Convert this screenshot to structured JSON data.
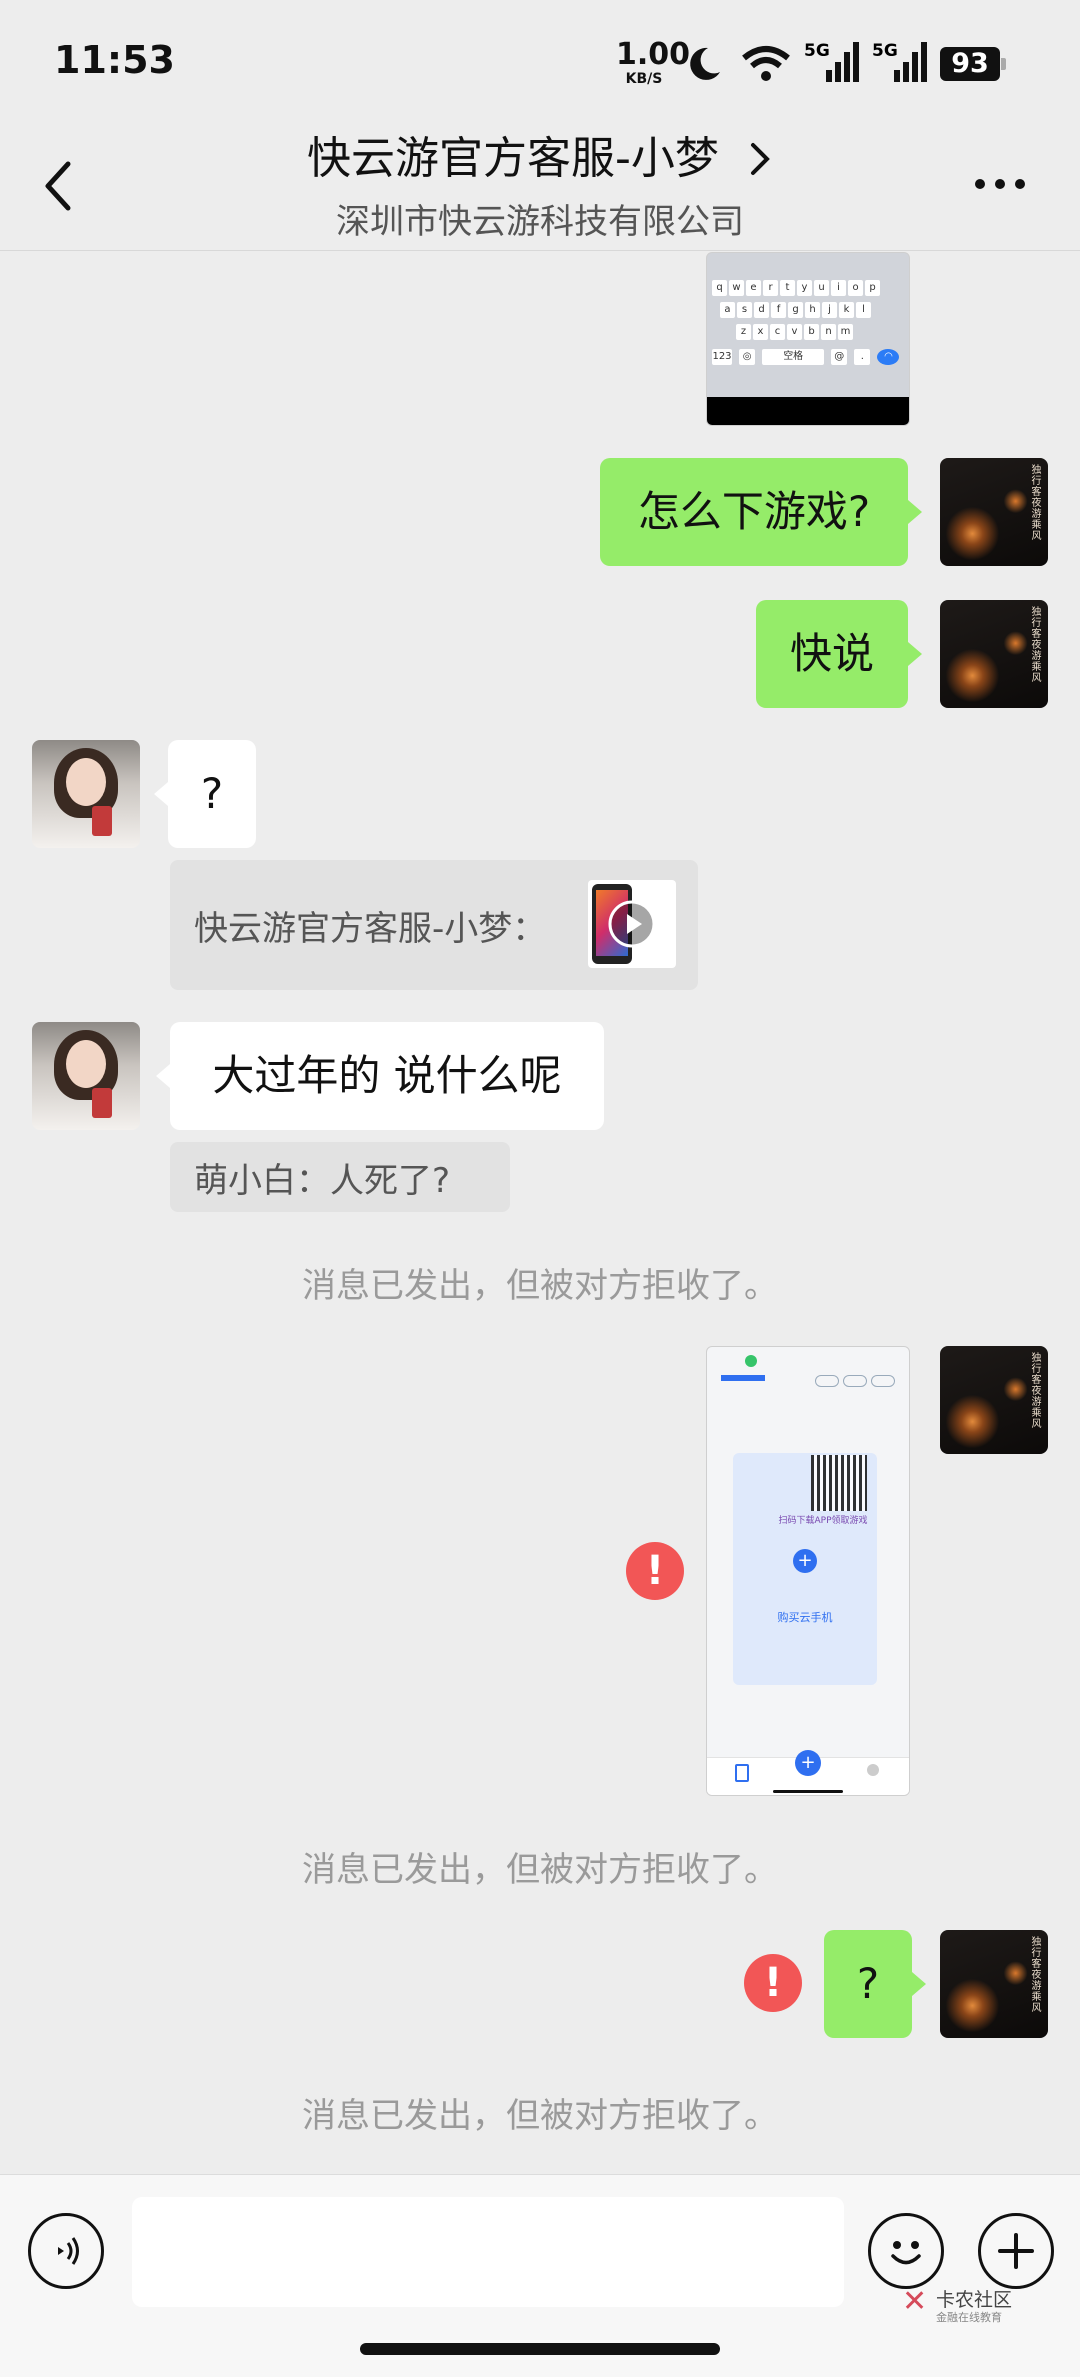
{
  "status_bar": {
    "time": "11:53",
    "net_speed_value": "1.00",
    "net_speed_unit": "KB/S",
    "battery": "93",
    "icons": [
      "moon-icon",
      "wifi-icon",
      "signal-5g-icon",
      "signal-5g-icon"
    ]
  },
  "header": {
    "title": "快云游官方客服-小梦",
    "subtitle": "深圳市快云游科技有限公司",
    "back_icon": "chevron-left-icon",
    "title_arrow_icon": "chevron-right-icon",
    "more_icon": "more-icon"
  },
  "keyboard_rows": [
    [
      "q",
      "w",
      "e",
      "r",
      "t",
      "y",
      "u",
      "i",
      "o",
      "p"
    ],
    [
      "a",
      "s",
      "d",
      "f",
      "g",
      "h",
      "j",
      "k",
      "l"
    ],
    [
      "z",
      "x",
      "c",
      "v",
      "b",
      "n",
      "m"
    ]
  ],
  "keyboard_bottom": {
    "num": "123",
    "space": "空格"
  },
  "messages": {
    "m1": "怎么下游戏?",
    "m2": "快说",
    "m3": "?",
    "quote1": "快云游官方客服-小梦：",
    "m4": "大过年的 说什么呢",
    "quote2": "萌小白：人死了?",
    "sys1": "消息已发出，但被对方拒收了。",
    "shot2_plus_label": "购买云手机",
    "shot2_qr_caption": "扫码下载APP领取游戏",
    "sys2": "消息已发出，但被对方拒收了。",
    "m5": "?",
    "sys3": "消息已发出，但被对方拒收了。",
    "error_mark": "!"
  },
  "footer": {
    "voice_icon": "voice-icon",
    "emoji_icon": "emoji-icon",
    "plus_icon": "plus-icon",
    "input_value": ""
  },
  "watermark": {
    "name": "卡农社区",
    "tagline": "金融在线教育"
  },
  "colors": {
    "bg": "#ededed",
    "bubble_green": "#95ec69",
    "error": "#f25656"
  }
}
